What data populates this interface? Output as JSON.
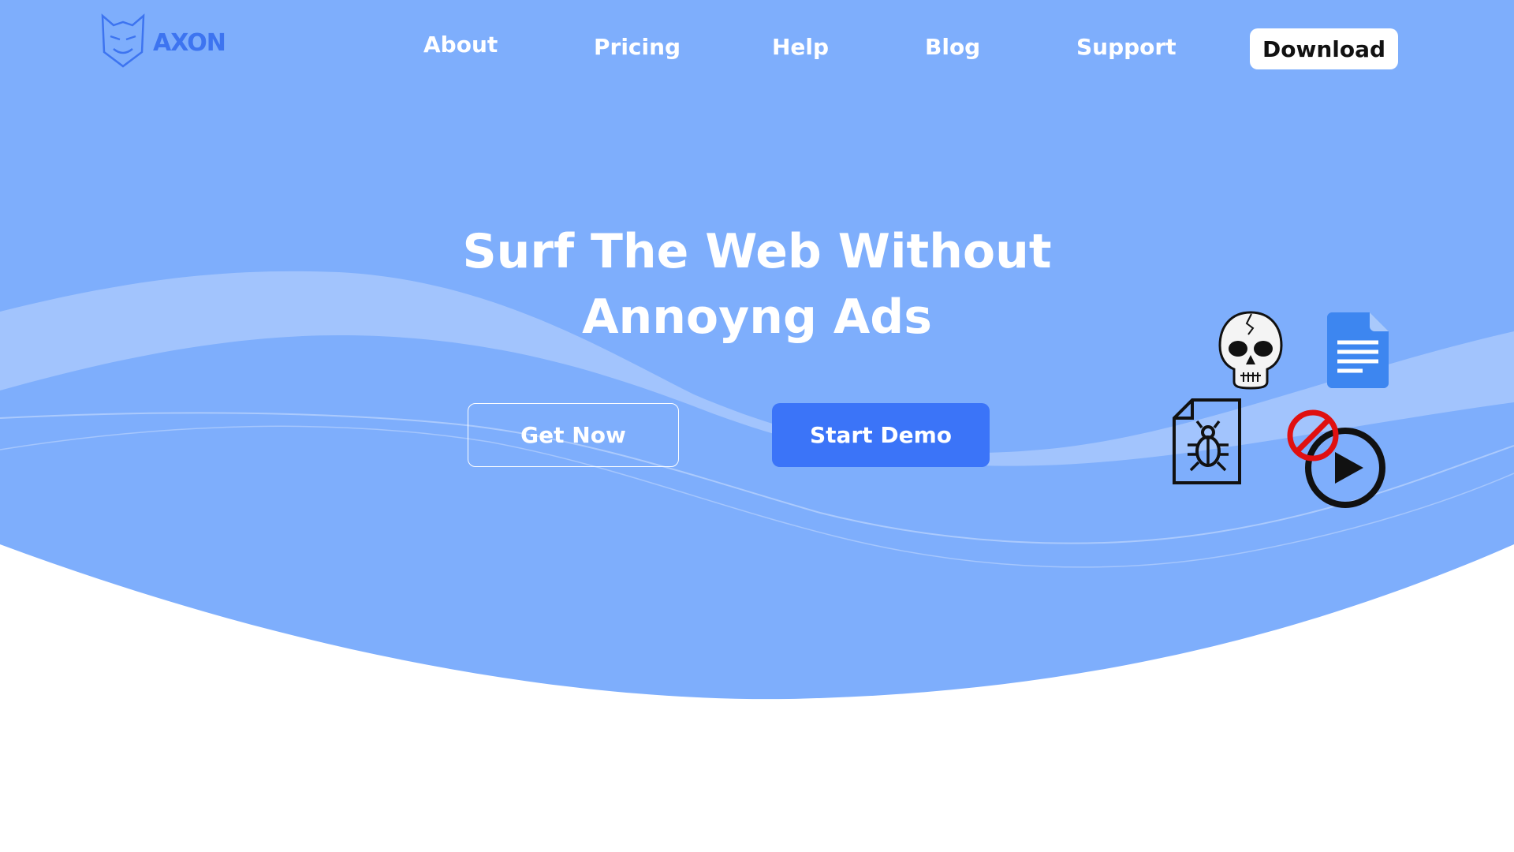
{
  "brand": {
    "name": "AXON",
    "logo_icon": "demon-mask-icon",
    "color": "#3d74f0"
  },
  "nav": {
    "items": [
      {
        "label": "About"
      },
      {
        "label": "Pricing"
      },
      {
        "label": "Help"
      },
      {
        "label": "Blog"
      },
      {
        "label": "Support"
      }
    ],
    "download_label": "Download"
  },
  "hero": {
    "headline_line1": "Surf The Web Without",
    "headline_line2": "Annoyng Ads",
    "primary_cta": "Get Now",
    "secondary_cta": "Start Demo",
    "background_color": "#7eaefc",
    "accent_color": "#3b74f8"
  },
  "illustration": {
    "icons": [
      "skull-icon",
      "document-icon",
      "bug-file-icon",
      "blocked-video-icon"
    ]
  }
}
